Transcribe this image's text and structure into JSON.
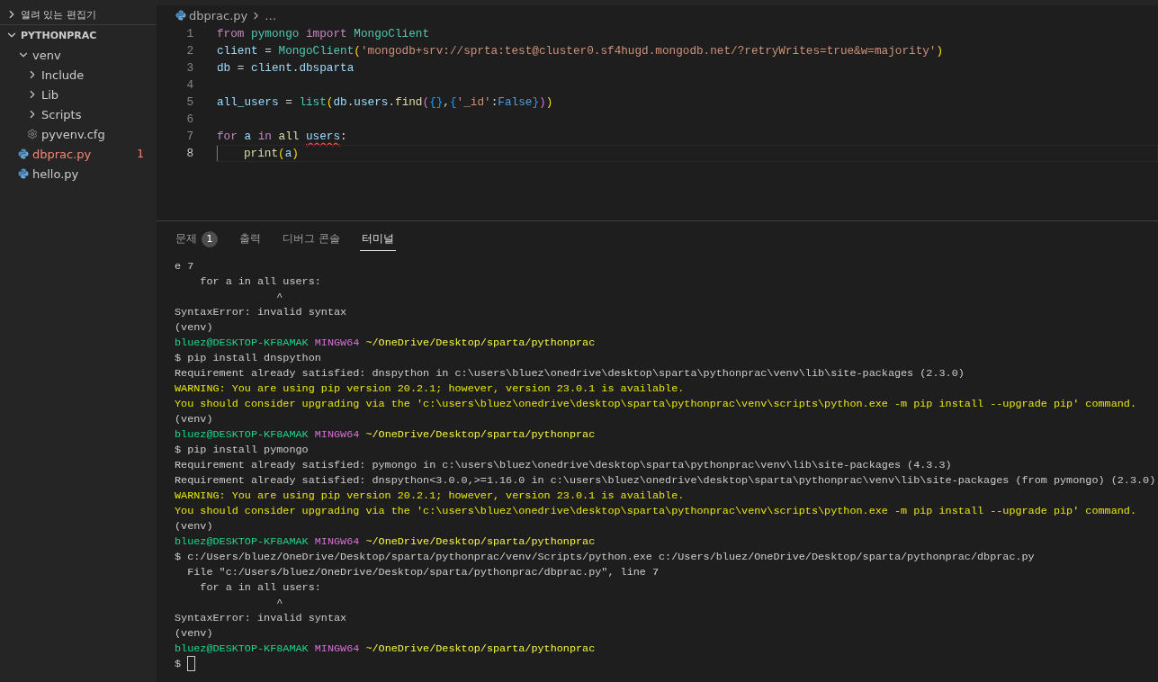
{
  "sidebar": {
    "sections": [
      {
        "title": "열려 있는 편집기",
        "expanded": false
      },
      {
        "title": "PYTHONPRAC",
        "expanded": true,
        "tree": [
          {
            "label": "venv",
            "kind": "folder",
            "expanded": true,
            "error": false,
            "children": [
              {
                "label": "Include",
                "kind": "folder",
                "expanded": false,
                "error": false
              },
              {
                "label": "Lib",
                "kind": "folder",
                "expanded": false,
                "error": false
              },
              {
                "label": "Scripts",
                "kind": "folder",
                "expanded": false,
                "error": false
              },
              {
                "label": "pyvenv.cfg",
                "kind": "config",
                "error": false
              }
            ]
          },
          {
            "label": "dbprac.py",
            "kind": "python",
            "error": true,
            "problems": "1"
          },
          {
            "label": "hello.py",
            "kind": "python",
            "error": false
          }
        ]
      }
    ]
  },
  "editor": {
    "breadcrumb": {
      "file": "dbprac.py",
      "trail": "…"
    },
    "lines": [
      {
        "number": "1",
        "current": false,
        "tokens": [
          {
            "kind": "keyword",
            "text": "from"
          },
          {
            "kind": "module",
            "text": " pymongo"
          },
          {
            "kind": "keyword",
            "text": " import"
          },
          {
            "kind": "module",
            "text": " MongoClient"
          }
        ]
      },
      {
        "number": "2",
        "current": false,
        "tokens": [
          {
            "kind": "variable",
            "text": "client"
          },
          {
            "kind": "plain",
            "text": " = "
          },
          {
            "kind": "module",
            "text": "MongoClient"
          },
          {
            "kind": "bracket1",
            "text": "("
          },
          {
            "kind": "string",
            "text": "'mongodb+srv://sprta:test@cluster0.sf4hugd.mongodb.net/?retryWrites=true&w=majority'"
          },
          {
            "kind": "bracket1",
            "text": ")"
          }
        ]
      },
      {
        "number": "3",
        "current": false,
        "tokens": [
          {
            "kind": "variable",
            "text": "db"
          },
          {
            "kind": "plain",
            "text": " = "
          },
          {
            "kind": "variable",
            "text": "client"
          },
          {
            "kind": "plain",
            "text": "."
          },
          {
            "kind": "variable",
            "text": "dbsparta"
          }
        ]
      },
      {
        "number": "4",
        "current": false
      },
      {
        "number": "5",
        "current": false,
        "tokens": [
          {
            "kind": "variable",
            "text": "all_users"
          },
          {
            "kind": "plain",
            "text": " = "
          },
          {
            "kind": "module",
            "text": "list"
          },
          {
            "kind": "bracket1",
            "text": "("
          },
          {
            "kind": "variable",
            "text": "db"
          },
          {
            "kind": "plain",
            "text": "."
          },
          {
            "kind": "variable",
            "text": "users"
          },
          {
            "kind": "plain",
            "text": "."
          },
          {
            "kind": "function",
            "text": "find"
          },
          {
            "kind": "bracket2",
            "text": "("
          },
          {
            "kind": "bracket3",
            "text": "{}"
          },
          {
            "kind": "plain",
            "text": ","
          },
          {
            "kind": "bracket3",
            "text": "{"
          },
          {
            "kind": "string",
            "text": "'_id'"
          },
          {
            "kind": "plain",
            "text": ":"
          },
          {
            "kind": "constant",
            "text": "False"
          },
          {
            "kind": "bracket3",
            "text": "}"
          },
          {
            "kind": "bracket2",
            "text": ")"
          },
          {
            "kind": "bracket1",
            "text": ")"
          }
        ]
      },
      {
        "number": "6",
        "current": false
      },
      {
        "number": "7",
        "current": false,
        "tokens": [
          {
            "kind": "keyword",
            "text": "for"
          },
          {
            "kind": "variable",
            "text": " a"
          },
          {
            "kind": "keyword",
            "text": " in"
          },
          {
            "kind": "function",
            "text": " all "
          },
          {
            "kind": "variable-error",
            "text": "users"
          },
          {
            "kind": "plain",
            "text": ":"
          }
        ]
      },
      {
        "number": "8",
        "current": true,
        "tokens": [
          {
            "kind": "function",
            "text": "print",
            "indented": true
          },
          {
            "kind": "bracket1",
            "text": "("
          },
          {
            "kind": "variable",
            "text": "a"
          },
          {
            "kind": "bracket1",
            "text": ")"
          }
        ]
      }
    ]
  },
  "panel": {
    "tabs": [
      {
        "label": "문제",
        "badge": "1",
        "selected": false
      },
      {
        "label": "출력",
        "selected": false
      },
      {
        "label": "디버그 콘솔",
        "selected": false
      },
      {
        "label": "터미널",
        "selected": true
      }
    ],
    "terminal": [
      [
        {
          "kind": "plain",
          "text": "e 7"
        }
      ],
      [
        {
          "kind": "plain",
          "text": "    for a in all users:"
        }
      ],
      [
        {
          "kind": "plain",
          "text": "                ^"
        }
      ],
      [
        {
          "kind": "plain",
          "text": "SyntaxError: invalid syntax"
        }
      ],
      [
        {
          "kind": "plain",
          "text": "(venv)"
        }
      ],
      [
        {
          "kind": "user",
          "text": "bluez@DESKTOP-KF8AMAK"
        },
        {
          "kind": "host",
          "text": " MINGW64"
        },
        {
          "kind": "path",
          "text": " ~/OneDrive/Desktop/sparta/pythonprac"
        }
      ],
      [
        {
          "kind": "plain",
          "text": "$ pip install dnspython"
        }
      ],
      [
        {
          "kind": "plain",
          "text": "Requirement already satisfied: dnspython in c:\\users\\bluez\\onedrive\\desktop\\sparta\\pythonprac\\venv\\lib\\site-packages (2.3.0)"
        }
      ],
      [
        {
          "kind": "warning",
          "text": "WARNING: You are using pip version 20.2.1; however, version 23.0.1 is available."
        }
      ],
      [
        {
          "kind": "warning",
          "text": "You should consider upgrading via the 'c:\\users\\bluez\\onedrive\\desktop\\sparta\\pythonprac\\venv\\scripts\\python.exe -m pip install --upgrade pip' command."
        }
      ],
      [
        {
          "kind": "plain",
          "text": "(venv)"
        }
      ],
      [
        {
          "kind": "user",
          "text": "bluez@DESKTOP-KF8AMAK"
        },
        {
          "kind": "host",
          "text": " MINGW64"
        },
        {
          "kind": "path",
          "text": " ~/OneDrive/Desktop/sparta/pythonprac"
        }
      ],
      [
        {
          "kind": "plain",
          "text": "$ pip install pymongo"
        }
      ],
      [
        {
          "kind": "plain",
          "text": "Requirement already satisfied: pymongo in c:\\users\\bluez\\onedrive\\desktop\\sparta\\pythonprac\\venv\\lib\\site-packages (4.3.3)"
        }
      ],
      [
        {
          "kind": "plain",
          "text": "Requirement already satisfied: dnspython<3.0.0,>=1.16.0 in c:\\users\\bluez\\onedrive\\desktop\\sparta\\pythonprac\\venv\\lib\\site-packages (from pymongo) (2.3.0)"
        }
      ],
      [
        {
          "kind": "warning",
          "text": "WARNING: You are using pip version 20.2.1; however, version 23.0.1 is available."
        }
      ],
      [
        {
          "kind": "warning",
          "text": "You should consider upgrading via the 'c:\\users\\bluez\\onedrive\\desktop\\sparta\\pythonprac\\venv\\scripts\\python.exe -m pip install --upgrade pip' command."
        }
      ],
      [
        {
          "kind": "plain",
          "text": "(venv)"
        }
      ],
      [
        {
          "kind": "user",
          "text": "bluez@DESKTOP-KF8AMAK"
        },
        {
          "kind": "host",
          "text": " MINGW64"
        },
        {
          "kind": "path",
          "text": " ~/OneDrive/Desktop/sparta/pythonprac"
        }
      ],
      [
        {
          "kind": "plain",
          "text": "$ c:/Users/bluez/OneDrive/Desktop/sparta/pythonprac/venv/Scripts/python.exe c:/Users/bluez/OneDrive/Desktop/sparta/pythonprac/dbprac.py"
        }
      ],
      [
        {
          "kind": "plain",
          "text": "  File \"c:/Users/bluez/OneDrive/Desktop/sparta/pythonprac/dbprac.py\", line 7"
        }
      ],
      [
        {
          "kind": "plain",
          "text": "    for a in all users:"
        }
      ],
      [
        {
          "kind": "plain",
          "text": "                ^"
        }
      ],
      [
        {
          "kind": "plain",
          "text": "SyntaxError: invalid syntax"
        }
      ],
      [
        {
          "kind": "plain",
          "text": "(venv)"
        }
      ],
      [
        {
          "kind": "user",
          "text": "bluez@DESKTOP-KF8AMAK"
        },
        {
          "kind": "host",
          "text": " MINGW64"
        },
        {
          "kind": "path",
          "text": " ~/OneDrive/Desktop/sparta/pythonprac"
        }
      ],
      [
        {
          "kind": "plain",
          "text": "$ "
        }
      ]
    ]
  }
}
